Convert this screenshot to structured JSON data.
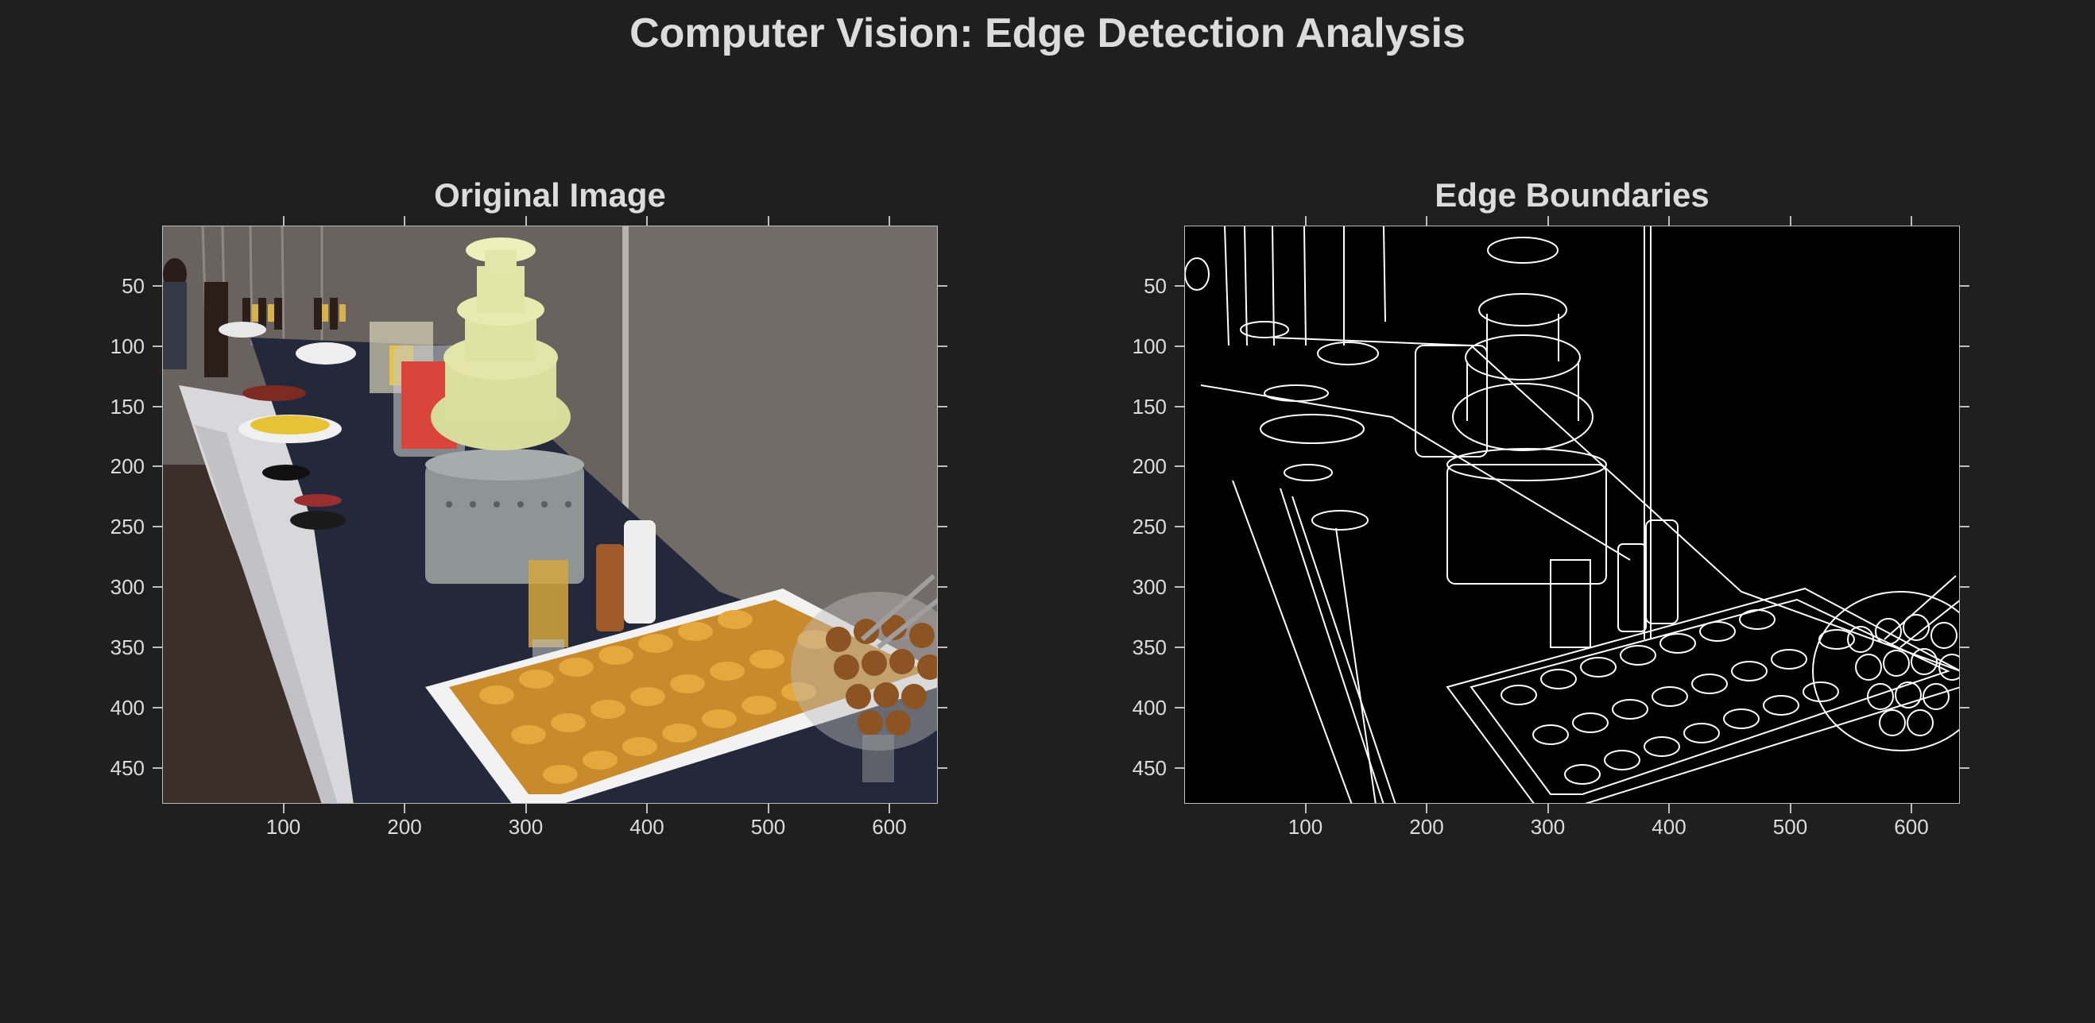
{
  "figure": {
    "title": "Computer Vision: Edge Detection Analysis"
  },
  "panels": [
    {
      "title": "Original Image"
    },
    {
      "title": "Edge Boundaries"
    }
  ],
  "axes": {
    "x_ticks": [
      "100",
      "200",
      "300",
      "400",
      "500",
      "600"
    ],
    "y_ticks": [
      "50",
      "100",
      "150",
      "200",
      "250",
      "300",
      "350",
      "400",
      "450"
    ],
    "x_values": [
      100,
      200,
      300,
      400,
      500,
      600
    ],
    "y_values": [
      50,
      100,
      150,
      200,
      250,
      300,
      350,
      400,
      450
    ],
    "x_range": [
      0,
      640
    ],
    "y_range": [
      0,
      480
    ]
  },
  "colors": {
    "background": "#1f1f1f",
    "text": "#dcdcdc",
    "edge_background": "#000000",
    "edge_lines": "#ffffff"
  }
}
